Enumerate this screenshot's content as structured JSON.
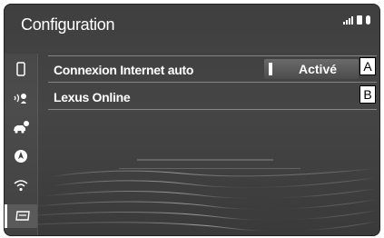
{
  "header": {
    "title": "Configuration"
  },
  "sidebar": {
    "items": [
      {
        "icon": "phone-icon"
      },
      {
        "icon": "voice-icon"
      },
      {
        "icon": "car-settings-icon"
      },
      {
        "icon": "navigation-icon"
      },
      {
        "icon": "wifi-icon"
      },
      {
        "icon": "display-icon",
        "active": true
      }
    ]
  },
  "settings": {
    "rows": [
      {
        "label": "Connexion Internet auto",
        "value": "Activé",
        "callout": "A"
      },
      {
        "label": "Lexus Online",
        "callout": "B"
      }
    ]
  },
  "colors": {
    "background": "#3f3f3f",
    "text": "#ffffff",
    "accent": "#ffffff"
  }
}
